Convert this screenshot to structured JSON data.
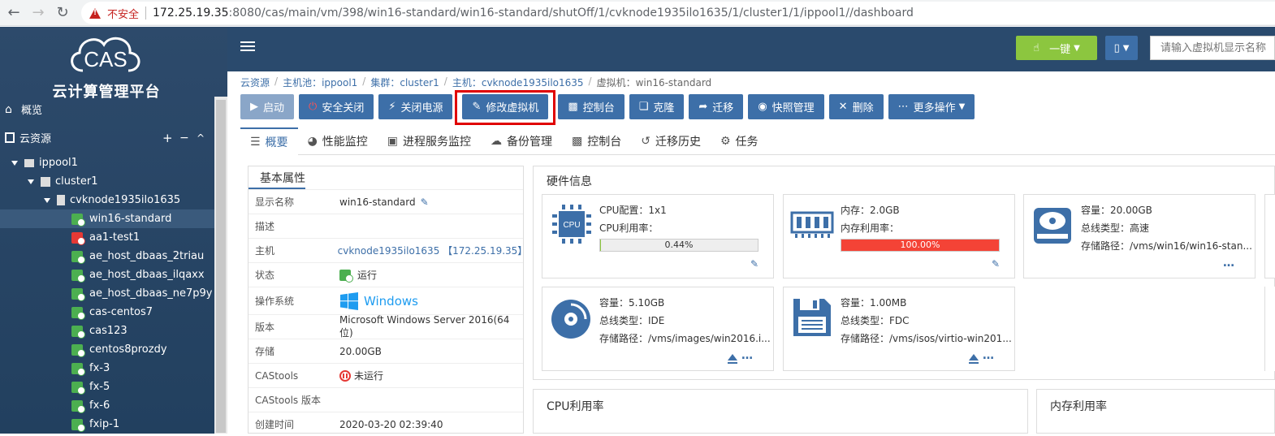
{
  "browser": {
    "insecure_label": "不安全",
    "url_host": "172.25.19.35",
    "url_path": ":8080/cas/main/vm/398/win16-standard/win16-standard/shutOff/1/cvknode1935ilo1635/1/cluster1/1/ippool1//dashboard"
  },
  "sidebar": {
    "logo_text": "CAS",
    "platform_name": "云计算管理平台",
    "overview_label": "概览",
    "cloud_resources_label": "云资源",
    "cloud_res_plus": "+",
    "cloud_res_minus": "−",
    "cloud_res_collapse": "^",
    "tree": [
      {
        "label": "ippool1",
        "level": 0
      },
      {
        "label": "cluster1",
        "level": 1
      },
      {
        "label": "cvknode1935ilo1635",
        "level": 2
      }
    ],
    "vms": [
      {
        "label": "win16-standard",
        "status": "green",
        "selected": true
      },
      {
        "label": "aa1-test1",
        "status": "red"
      },
      {
        "label": "ae_host_dbaas_2triau",
        "status": "green"
      },
      {
        "label": "ae_host_dbaas_ilqaxx",
        "status": "green"
      },
      {
        "label": "ae_host_dbaas_ne7p9y",
        "status": "green"
      },
      {
        "label": "cas-centos7",
        "status": "green"
      },
      {
        "label": "cas123",
        "status": "green"
      },
      {
        "label": "centos8prozdy",
        "status": "green"
      },
      {
        "label": "fx-3",
        "status": "green"
      },
      {
        "label": "fx-5",
        "status": "green"
      },
      {
        "label": "fx-6",
        "status": "green"
      },
      {
        "label": "fxip-1",
        "status": "green"
      }
    ]
  },
  "topbar": {
    "onekey_label": "一键",
    "search_placeholder": "请输入虚拟机显示名称"
  },
  "breadcrumb": {
    "root": "云资源",
    "hostpool": "主机池：ippool1",
    "cluster": "集群：cluster1",
    "host": "主机：cvknode1935ilo1635",
    "vm": "虚拟机：win16-standard"
  },
  "toolbar": {
    "start": "启动",
    "safe_shutdown": "安全关闭",
    "power_off": "关闭电源",
    "modify_vm": "修改虚拟机",
    "console": "控制台",
    "clone": "克隆",
    "migrate": "迁移",
    "snapshot": "快照管理",
    "delete": "删除",
    "more": "更多操作"
  },
  "tabs": {
    "overview": "概要",
    "perf": "性能监控",
    "process": "进程服务监控",
    "backup": "备份管理",
    "console": "控制台",
    "migrate_history": "迁移历史",
    "tasks": "任务"
  },
  "basic": {
    "title": "基本属性",
    "rows": [
      {
        "k": "显示名称",
        "v": "win16-standard"
      },
      {
        "k": "描述",
        "v": ""
      },
      {
        "k": "主机",
        "v": "cvknode1935ilo1635 【172.25.19.35】"
      },
      {
        "k": "状态",
        "v": "运行"
      },
      {
        "k": "操作系统",
        "v": "Windows"
      },
      {
        "k": "版本",
        "v": "Microsoft Windows Server 2016(64位)"
      },
      {
        "k": "存储",
        "v": "20.00GB"
      },
      {
        "k": "CAStools",
        "v": "未运行"
      },
      {
        "k": "CAStools 版本",
        "v": ""
      },
      {
        "k": "创建时间",
        "v": "2020-03-20 02:39:40"
      }
    ]
  },
  "hardware": {
    "title": "硬件信息",
    "cpu": {
      "config": "CPU配置：1x1",
      "usage_label": "CPU利用率：",
      "usage": "0.44%",
      "usage_fraction": 0.0044,
      "icon_text": "CPU"
    },
    "mem": {
      "size": "内存：2.0GB",
      "usage_label": "内存利用率：",
      "usage": "100.00%",
      "usage_fraction": 1.0
    },
    "disk": {
      "capacity": "容量：20.00GB",
      "bus": "总线类型：高速",
      "path": "存储路径：/vms/win16/win16-stan..."
    },
    "cdrom": {
      "capacity": "容量：5.10GB",
      "bus": "总线类型：IDE",
      "path": "存储路径：/vms/images/win2016.i..."
    },
    "floppy": {
      "capacity": "容量：1.00MB",
      "bus": "总线类型：FDC",
      "path": "存储路径：/vms/isos/virtio-win201..."
    }
  },
  "usage_panels": {
    "cpu_title": "CPU利用率",
    "mem_title": "内存利用率"
  },
  "colors": {
    "accent": "#3d6fa8",
    "green": "#8cc63f",
    "danger": "#f44336",
    "highlight": "#e00000"
  }
}
